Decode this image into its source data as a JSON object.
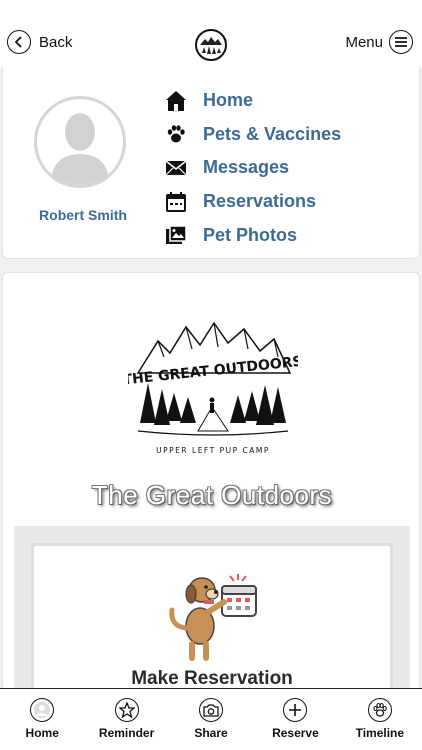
{
  "header": {
    "back_label": "Back",
    "menu_label": "Menu"
  },
  "profile": {
    "name": "Robert Smith"
  },
  "nav": {
    "items": [
      {
        "label": "Home",
        "icon": "home-icon"
      },
      {
        "label": "Pets & Vaccines",
        "icon": "paw-icon"
      },
      {
        "label": "Messages",
        "icon": "envelope-icon"
      },
      {
        "label": "Reservations",
        "icon": "calendar-icon"
      },
      {
        "label": "Pet Photos",
        "icon": "photos-icon"
      }
    ]
  },
  "main": {
    "logo_line1": "THE GREAT OUTDOORS",
    "logo_line2": "UPPER LEFT PUP CAMP",
    "title": "The Great Outdoors",
    "reservation_label": "Make Reservation"
  },
  "tabbar": {
    "items": [
      {
        "label": "Home",
        "icon": "avatar-icon"
      },
      {
        "label": "Reminder",
        "icon": "star-icon"
      },
      {
        "label": "Share",
        "icon": "camera-icon"
      },
      {
        "label": "Reserve",
        "icon": "plus-icon"
      },
      {
        "label": "Timeline",
        "icon": "paw-icon"
      }
    ]
  },
  "colors": {
    "accent": "#3d6a96",
    "text": "#111111",
    "background": "#f0f0f0"
  }
}
